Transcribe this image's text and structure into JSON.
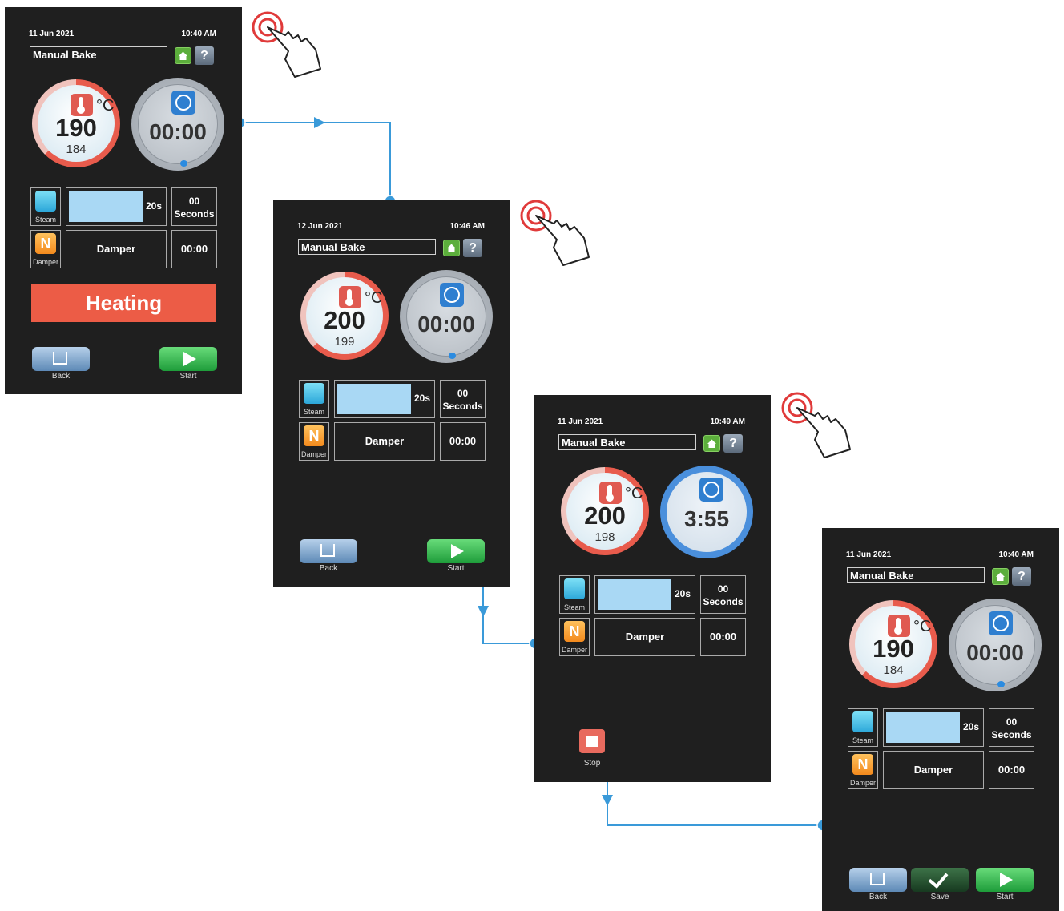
{
  "screens": [
    {
      "date": "11 Jun 2021",
      "time": "10:40 AM",
      "title": "Manual Bake",
      "temp_set": "190",
      "temp_actual": "184",
      "unit": "°C",
      "timer": "00:00",
      "steam_label": "Steam",
      "steam_value": "20s",
      "seconds_value": "00",
      "seconds_unit": "Seconds",
      "damper_label": "Damper",
      "damper_text": "Damper",
      "damper_time": "00:00",
      "status": "Heating",
      "back_label": "Back",
      "start_label": "Start"
    },
    {
      "date": "12 Jun 2021",
      "time": "10:46 AM",
      "title": "Manual Bake",
      "temp_set": "200",
      "temp_actual": "199",
      "unit": "°C",
      "timer": "00:00",
      "steam_label": "Steam",
      "steam_value": "20s",
      "seconds_value": "00",
      "seconds_unit": "Seconds",
      "damper_label": "Damper",
      "damper_text": "Damper",
      "damper_time": "00:00",
      "back_label": "Back",
      "start_label": "Start"
    },
    {
      "date": "11 Jun 2021",
      "time": "10:49 AM",
      "title": "Manual Bake",
      "temp_set": "200",
      "temp_actual": "198",
      "unit": "°C",
      "timer": "3:55",
      "steam_label": "Steam",
      "steam_value": "20s",
      "seconds_value": "00",
      "seconds_unit": "Seconds",
      "damper_label": "Damper",
      "damper_text": "Damper",
      "damper_time": "00:00",
      "stop_label": "Stop"
    },
    {
      "date": "11 Jun 2021",
      "time": "10:40 AM",
      "title": "Manual Bake",
      "temp_set": "190",
      "temp_actual": "184",
      "unit": "°C",
      "timer": "00:00",
      "steam_label": "Steam",
      "steam_value": "20s",
      "seconds_value": "00",
      "seconds_unit": "Seconds",
      "damper_label": "Damper",
      "damper_text": "Damper",
      "damper_time": "00:00",
      "back_label": "Back",
      "save_label": "Save",
      "start_label": "Start"
    }
  ],
  "colors": {
    "flow_line": "#3a9ad9",
    "heating": "#ec5c46",
    "screen_bg": "#1f1f1f"
  },
  "icons": [
    "home-icon",
    "help-icon",
    "thermometer-icon",
    "clock-icon",
    "steam-icon",
    "damper-icon",
    "back-icon",
    "start-icon",
    "save-icon",
    "stop-icon",
    "tap-hand-icon"
  ]
}
